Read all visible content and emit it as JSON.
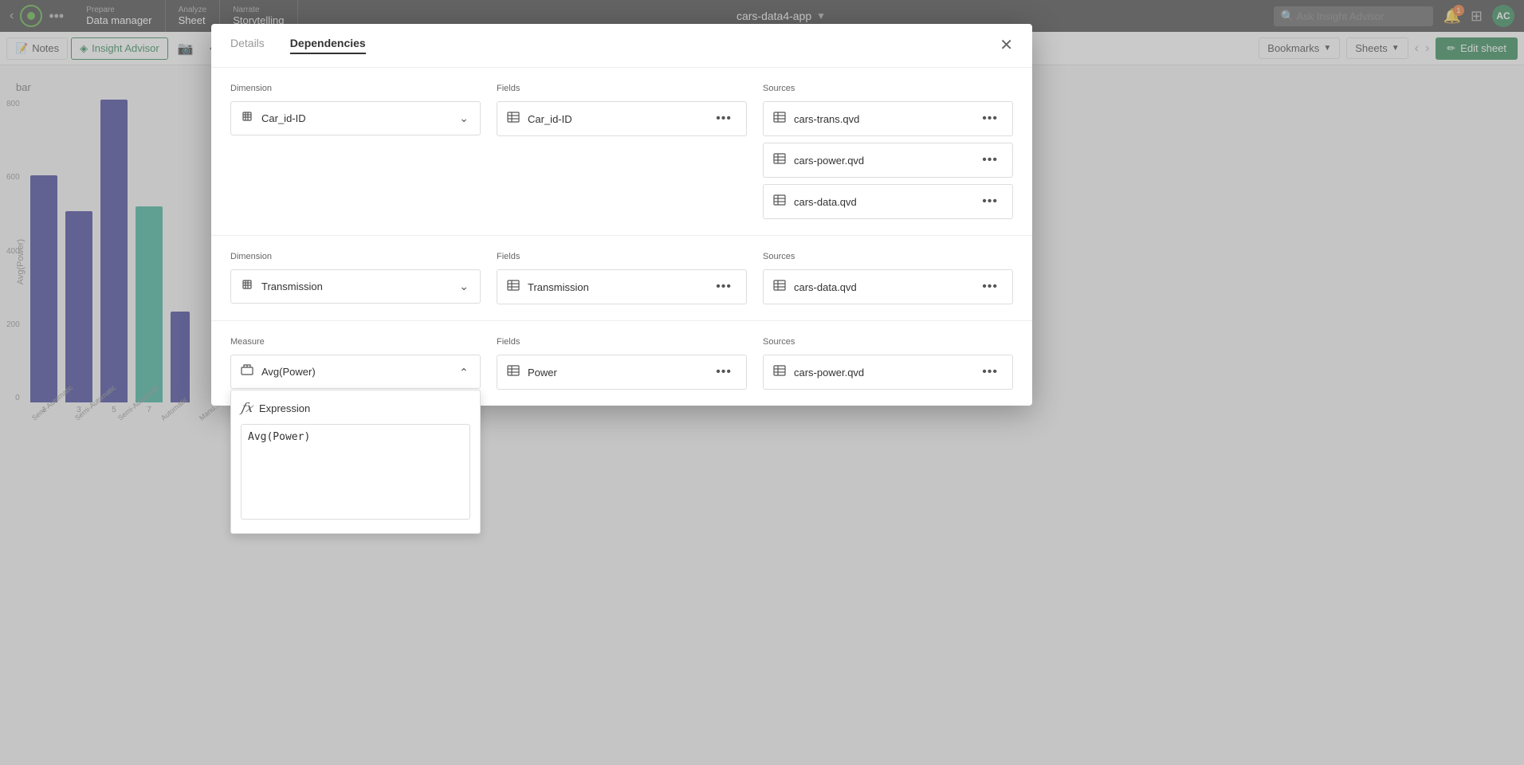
{
  "topbar": {
    "app_name": "cars-data4-app",
    "sections": [
      {
        "label": "Prepare",
        "name": "Data manager"
      },
      {
        "label": "Analyze",
        "name": "Sheet"
      },
      {
        "label": "Narrate",
        "name": "Storytelling"
      }
    ],
    "search_placeholder": "Ask Insight Advisor",
    "notification_count": "1",
    "avatar_initials": "AC"
  },
  "toolbar2": {
    "notes_label": "Notes",
    "insight_advisor_label": "Insight Advisor",
    "bookmarks_label": "Bookmarks",
    "sheets_label": "Sheets",
    "edit_sheet_label": "Edit sheet"
  },
  "chart": {
    "title": "bar",
    "y_label": "Avg(Power)",
    "y_values": [
      "800",
      "600",
      "400",
      "200",
      "0"
    ],
    "bars": [
      {
        "height_pct": 75,
        "color": "blue",
        "x_label": "1",
        "x_sublabel": "Semi-Automatic"
      },
      {
        "height_pct": 63,
        "color": "blue",
        "x_label": "3",
        "x_sublabel": "Semi-Automatic"
      },
      {
        "height_pct": 100,
        "color": "blue",
        "x_label": "5",
        "x_sublabel": "Semi-Automatic"
      },
      {
        "height_pct": 65,
        "color": "teal",
        "x_label": "7",
        "x_sublabel": "Automatic"
      },
      {
        "height_pct": 30,
        "color": "blue",
        "x_label": "",
        "x_sublabel": "Manu..."
      }
    ]
  },
  "modal": {
    "tab_details": "Details",
    "tab_dependencies": "Dependencies",
    "active_tab": "Dependencies",
    "rows": [
      {
        "left_title": "Dimension",
        "left_item": {
          "label": "Car_id-ID",
          "icon": "cube"
        },
        "mid_title": "Fields",
        "mid_item": {
          "label": "Car_id-ID",
          "icon": "table"
        },
        "right_title": "Sources",
        "right_items": [
          {
            "label": "cars-trans.qvd",
            "icon": "table"
          },
          {
            "label": "cars-power.qvd",
            "icon": "table"
          },
          {
            "label": "cars-data.qvd",
            "icon": "table"
          }
        ]
      },
      {
        "left_title": "Dimension",
        "left_item": {
          "label": "Transmission",
          "icon": "cube"
        },
        "mid_title": "Fields",
        "mid_item": {
          "label": "Transmission",
          "icon": "table"
        },
        "right_title": "Sources",
        "right_items": [
          {
            "label": "cars-data.qvd",
            "icon": "table"
          }
        ]
      },
      {
        "left_title": "Measure",
        "left_item": {
          "label": "Avg(Power)",
          "icon": "measure"
        },
        "mid_title": "Fields",
        "mid_item": {
          "label": "Power",
          "icon": "table"
        },
        "right_title": "Sources",
        "right_items": [
          {
            "label": "cars-power.qvd",
            "icon": "table"
          }
        ],
        "show_expression": true
      }
    ],
    "expression": {
      "label": "Expression",
      "value": "Avg(Power)"
    }
  }
}
